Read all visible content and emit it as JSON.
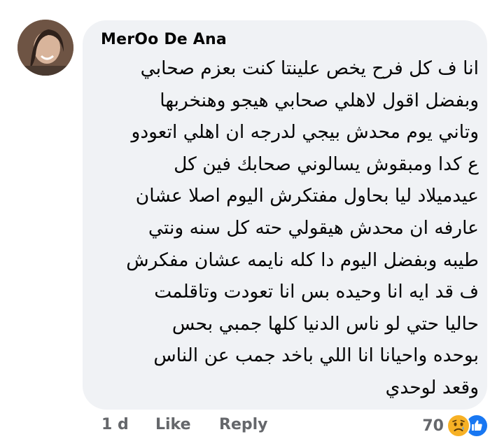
{
  "comment": {
    "author": "MerOo De Ana",
    "lines": [
      "انا ف كل فرح يخص علينتا كنت بعزم صحابي",
      "وبفضل اقول لاهلي صحابي هيجو وهنخربها",
      "وتاني يوم محدش بيجي لدرجه ان اهلي اتعودو",
      "ع كدا ومبقوش يسالوني صحابك فين كل",
      "عيدميلاد ليا بحاول مفتكرش اليوم اصلا عشان",
      "عارفه ان محدش هيقولي حته كل سنه ونتي",
      "طيبه وبفضل اليوم دا كله نايمه عشان مفكرش",
      "ف قد ايه انا وحيده بس انا تعودت وتاقلمت",
      "حاليا حتي لو ناس الدنيا كلها جمبي بحس",
      "بوحده واحيانا انا اللي باخد جمب عن الناس",
      "وقعد لوحدي"
    ]
  },
  "actions": {
    "time": "1 d",
    "like": "Like",
    "reply": "Reply"
  },
  "reactions": {
    "count": "70",
    "icons": [
      "sad-emoji-icon",
      "like-thumb-icon"
    ],
    "colors": {
      "sad": "#f7b125",
      "like": "#1877f2"
    }
  }
}
